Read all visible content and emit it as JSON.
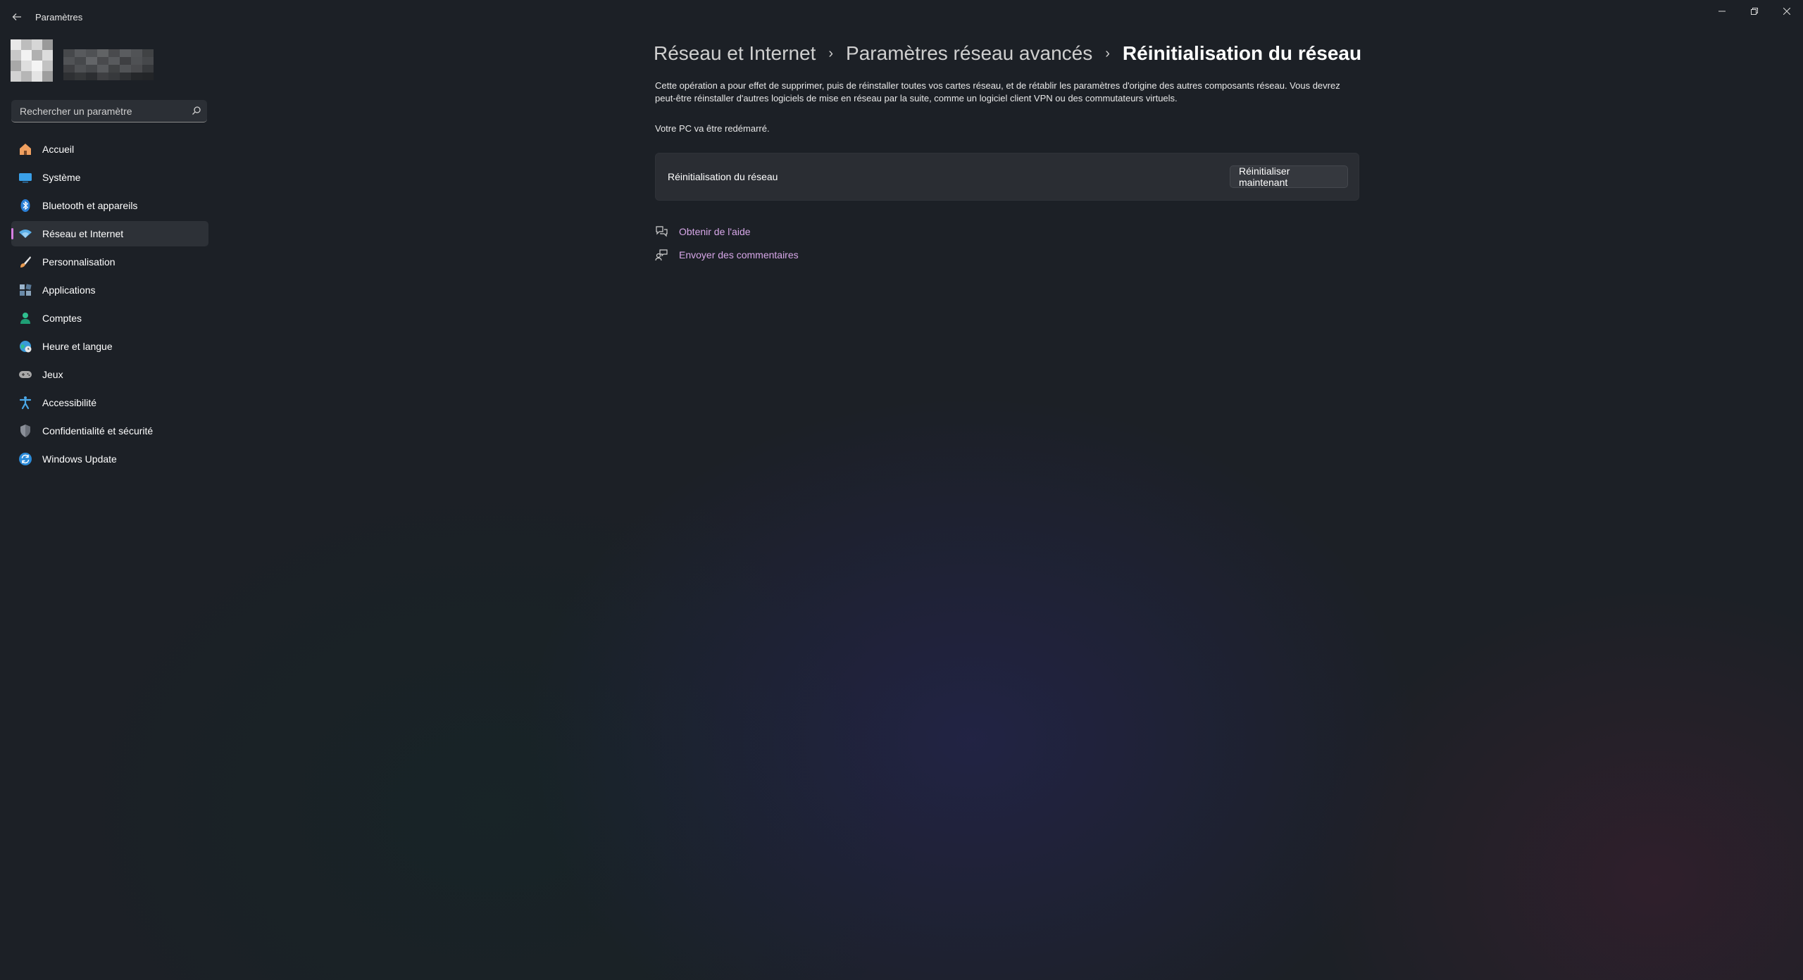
{
  "window": {
    "title": "Paramètres",
    "controls": {
      "minimize": "minimize-icon",
      "maximize": "restore-icon",
      "close": "close-icon"
    }
  },
  "profile": {
    "avatar": "avatar-pixelated",
    "name": ""
  },
  "search": {
    "placeholder": "Rechercher un paramètre",
    "value": ""
  },
  "sidebar": {
    "items": [
      {
        "label": "Accueil",
        "icon": "home-icon",
        "color": "#f0a060",
        "active": false
      },
      {
        "label": "Système",
        "icon": "system-icon",
        "color": "#3aa0e8",
        "active": false
      },
      {
        "label": "Bluetooth et appareils",
        "icon": "bluetooth-icon",
        "color": "#2a7fd6",
        "active": false
      },
      {
        "label": "Réseau et Internet",
        "icon": "wifi-icon",
        "color": "#5aaee8",
        "active": true
      },
      {
        "label": "Personnalisation",
        "icon": "brush-icon",
        "color": "#e89a50",
        "active": false
      },
      {
        "label": "Applications",
        "icon": "apps-icon",
        "color": "#7a9ab8",
        "active": false
      },
      {
        "label": "Comptes",
        "icon": "account-icon",
        "color": "#2fbf8f",
        "active": false
      },
      {
        "label": "Heure et langue",
        "icon": "globe-clock-icon",
        "color": "#3a9ad8",
        "active": false
      },
      {
        "label": "Jeux",
        "icon": "gamepad-icon",
        "color": "#a8a8a8",
        "active": false
      },
      {
        "label": "Accessibilité",
        "icon": "accessibility-icon",
        "color": "#4aa8e8",
        "active": false
      },
      {
        "label": "Confidentialité et sécurité",
        "icon": "shield-icon",
        "color": "#8a8f98",
        "active": false
      },
      {
        "label": "Windows Update",
        "icon": "update-icon",
        "color": "#2a8ad8",
        "active": false
      }
    ]
  },
  "breadcrumb": {
    "items": [
      "Réseau et Internet",
      "Paramètres réseau avancés"
    ],
    "current": "Réinitialisation du réseau"
  },
  "main": {
    "description": "Cette opération a pour effet de supprimer, puis de réinstaller toutes vos cartes réseau, et de rétablir les paramètres d'origine des autres composants réseau. Vous devrez peut-être réinstaller d'autres logiciels de mise en réseau par la suite, comme un logiciel client VPN ou des commutateurs virtuels.",
    "restart_note": "Votre PC va être redémarré.",
    "card": {
      "label": "Réinitialisation du réseau",
      "button": "Réinitialiser maintenant"
    },
    "links": [
      {
        "label": "Obtenir de l'aide",
        "icon": "help-chat-icon"
      },
      {
        "label": "Envoyer des commentaires",
        "icon": "feedback-icon"
      }
    ]
  },
  "colors": {
    "background": "#1c2026",
    "accent": "#d67ee0",
    "link": "#d7a7e8",
    "card": "#2a2d33"
  }
}
